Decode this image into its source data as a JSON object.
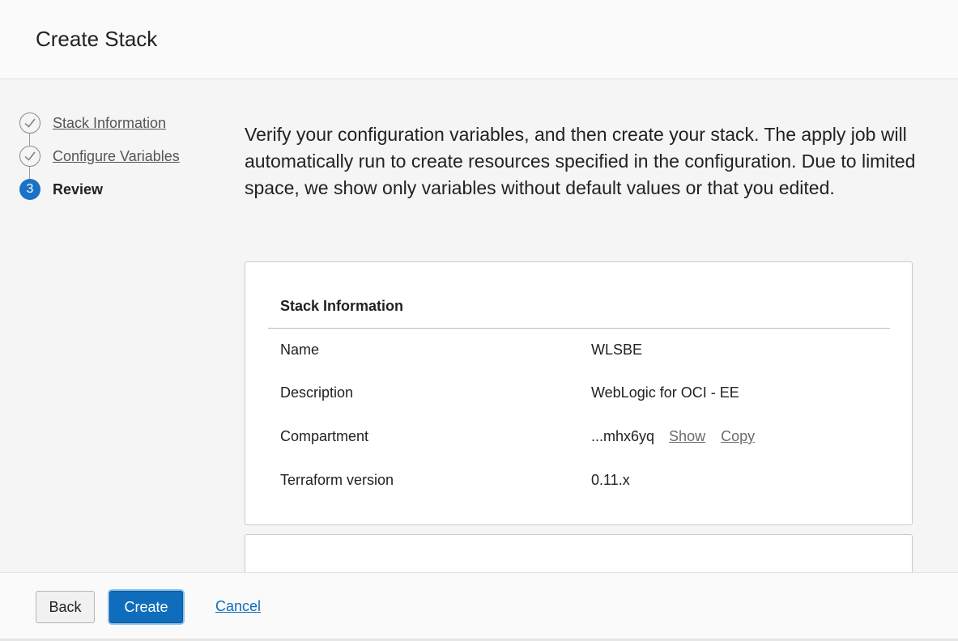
{
  "header": {
    "title": "Create Stack"
  },
  "steps": [
    {
      "label": "Stack Information",
      "status": "done"
    },
    {
      "label": "Configure Variables",
      "status": "done"
    },
    {
      "label": "Review",
      "status": "current",
      "number": "3"
    }
  ],
  "intro": "Verify your configuration variables, and then create your stack. The apply job will automatically run to create resources specified in the configuration. Due to limited space, we show only variables without default values or that you edited.",
  "stack_info": {
    "heading": "Stack Information",
    "rows": [
      {
        "key": "Name",
        "value": "WLSBE"
      },
      {
        "key": "Description",
        "value": "WebLogic for OCI - EE"
      },
      {
        "key": "Compartment",
        "value": "...mhx6yq",
        "show_label": "Show",
        "copy_label": "Copy"
      },
      {
        "key": "Terraform version",
        "value": "0.11.x"
      }
    ]
  },
  "footer": {
    "back_label": "Back",
    "create_label": "Create",
    "cancel_label": "Cancel"
  },
  "colors": {
    "accent": "#0f6dbc",
    "step_current": "#1a72c4"
  }
}
